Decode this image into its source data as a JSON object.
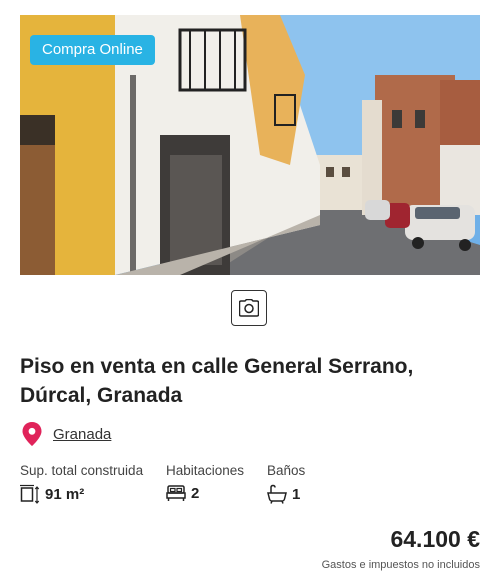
{
  "listing": {
    "badge": "Compra Online",
    "title": "Piso en venta en calle General Serrano, Dúrcal, Granada",
    "location": "Granada",
    "features": [
      {
        "label": "Sup. total construida",
        "value": "91 m²",
        "icon": "area-icon"
      },
      {
        "label": "Habitaciones",
        "value": "2",
        "icon": "bed-icon"
      },
      {
        "label": "Baños",
        "value": "1",
        "icon": "bathtub-icon"
      }
    ],
    "price": "64.100 €",
    "price_note": "Gastos e impuestos no incluidos"
  },
  "colors": {
    "badge_bg": "#29b3e4",
    "pin": "#e0235a"
  },
  "icons": {
    "camera": "camera-icon",
    "pin": "map-pin-icon"
  }
}
